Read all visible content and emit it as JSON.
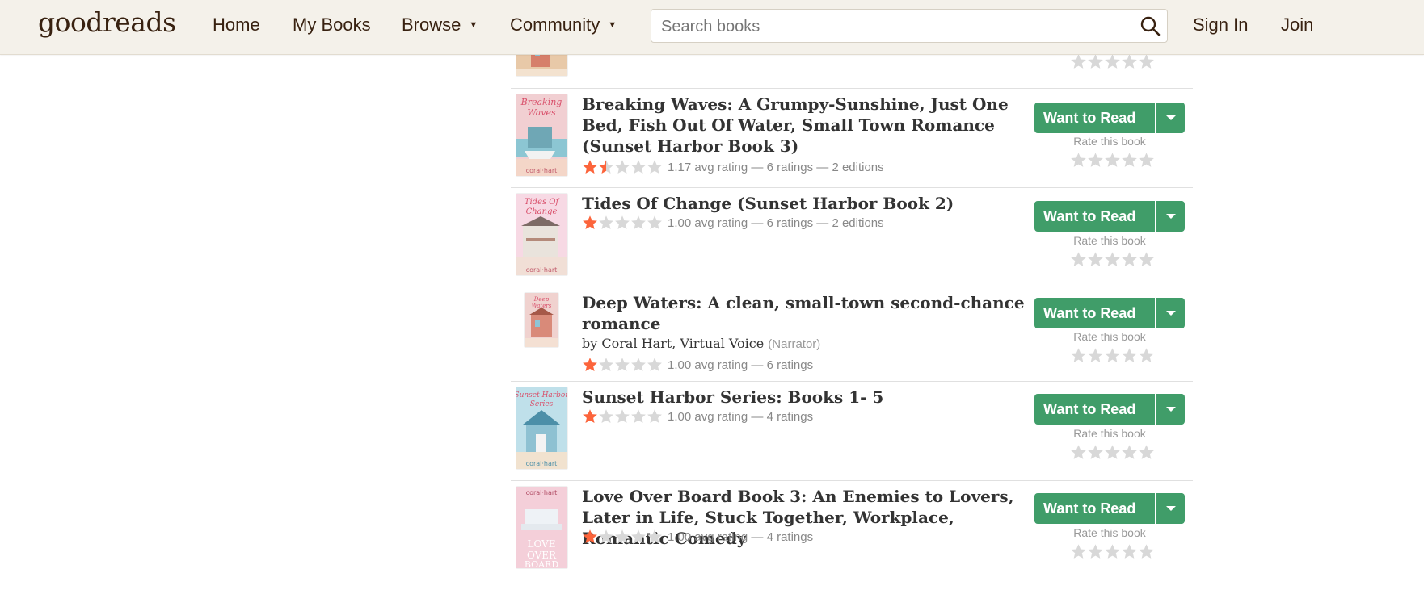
{
  "header": {
    "logo": "goodreads",
    "nav": [
      {
        "label": "Home",
        "caret": false
      },
      {
        "label": "My Books",
        "caret": false
      },
      {
        "label": "Browse",
        "caret": true
      },
      {
        "label": "Community",
        "caret": true
      }
    ],
    "search_placeholder": "Search books",
    "sign_in": "Sign In",
    "join": "Join"
  },
  "colors": {
    "header_bg": "#f4f1ea",
    "brand": "#382110",
    "button_green": "#409d69",
    "star_filled": "#fc643b",
    "star_empty": "#d8d8d8"
  },
  "books": [
    {
      "title": "Breaking Waves: A Grumpy-Sunshine, Just One Bed, Fish Out Of Water, Small Town Romance (Sunset Harbor Book 3)",
      "rating_value": 1.17,
      "stats": "1.17 avg rating — 6 ratings — 2 editions"
    },
    {
      "title": "Tides Of Change (Sunset Harbor Book 2)",
      "rating_value": 1.0,
      "stats": "1.00 avg rating — 6 ratings — 2 editions"
    },
    {
      "title": "Deep Waters: A clean, small-town second-chance romance",
      "by": "by",
      "authors": [
        "Coral Hart",
        "Virtual Voice"
      ],
      "narrator_role": "(Narrator)",
      "rating_value": 1.0,
      "stats": "1.00 avg rating — 6 ratings"
    },
    {
      "title": "Sunset Harbor Series: Books 1- 5",
      "rating_value": 1.0,
      "stats": "1.00 avg rating — 4 ratings"
    },
    {
      "title": "Love Over Board Book 3: An Enemies to Lovers, Later in Life, Stuck Together, Workplace, Romantic Comedy",
      "rating_value": 1.0,
      "stats": "1.00 avg rating — 4 ratings"
    }
  ],
  "actions": {
    "want_to_read": "Want to Read",
    "rate_label": "Rate this book"
  }
}
